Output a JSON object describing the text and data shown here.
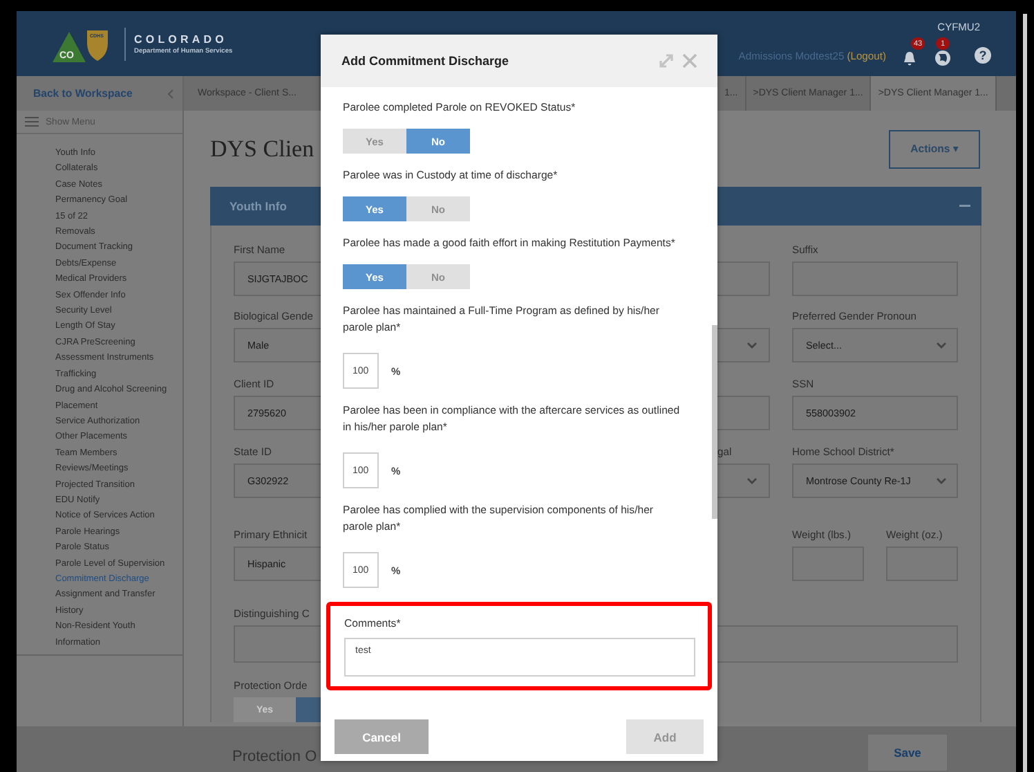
{
  "header": {
    "logo_mark": "CO",
    "logo_badge": "CDHS",
    "org_name": "COLORADO",
    "org_sub": "Department of Human Services",
    "user": "Admissions Modtest25",
    "logout": "(Logout)",
    "notifications": "43",
    "alerts": "1",
    "unit": "CYFMU2",
    "help": "?"
  },
  "sidebar": {
    "back": "Back to Workspace",
    "show_menu": "Show Menu",
    "items": [
      {
        "label": "Youth Info",
        "selected": false
      },
      {
        "label": "Collaterals",
        "selected": false
      },
      {
        "label": "Case Notes",
        "selected": false
      },
      {
        "label": "Permanency Goal",
        "selected": false
      },
      {
        "label": "15 of 22",
        "selected": false
      },
      {
        "label": "Removals",
        "selected": false
      },
      {
        "label": "Document Tracking",
        "selected": false
      },
      {
        "label": "Debts/Expense",
        "selected": false
      },
      {
        "label": "Medical Providers",
        "selected": false
      },
      {
        "label": "Sex Offender Info",
        "selected": false
      },
      {
        "label": "Security Level",
        "selected": false
      },
      {
        "label": "Length Of Stay",
        "selected": false
      },
      {
        "label": "CJRA PreScreening",
        "selected": false
      },
      {
        "label": "Assessment Instruments",
        "selected": false
      },
      {
        "label": "Trafficking",
        "selected": false
      },
      {
        "label": "Drug and Alcohol Screening",
        "selected": false
      },
      {
        "label": "Placement",
        "selected": false
      },
      {
        "label": "Service Authorization",
        "selected": false
      },
      {
        "label": "Other Placements",
        "selected": false
      },
      {
        "label": "Team Members",
        "selected": false
      },
      {
        "label": "Reviews/Meetings",
        "selected": false
      },
      {
        "label": "Projected Transition",
        "selected": false
      },
      {
        "label": "EDU Notify",
        "selected": false
      },
      {
        "label": "Notice of Services Action",
        "selected": false
      },
      {
        "label": "Parole Hearings",
        "selected": false
      },
      {
        "label": "Parole Status",
        "selected": false
      },
      {
        "label": "Parole Level of Supervision",
        "selected": false
      },
      {
        "label": "Commitment Discharge",
        "selected": true
      },
      {
        "label": "Assignment and Transfer History",
        "selected": false
      },
      {
        "label": "Non-Resident Youth Information",
        "selected": false
      }
    ]
  },
  "tabs": [
    {
      "label": "Workspace - Client S...",
      "selected": false
    },
    {
      "label": "1...",
      "selected": false
    },
    {
      "label": ">DYS Client Manager 1...",
      "selected": false
    },
    {
      "label": ">DYS Client Manager 1...",
      "selected": true
    }
  ],
  "main": {
    "title": "DYS Clien",
    "actions": "Actions ▾",
    "panel_title": "Youth Info",
    "form_left": [
      {
        "kind": "text",
        "label": "First Name",
        "value": "SIJGTAJBOC"
      },
      {
        "kind": "text",
        "label": "Biological Gende",
        "value": "Male"
      },
      {
        "kind": "text",
        "label": "Client ID",
        "value": "2795620"
      },
      {
        "kind": "text",
        "label": "State ID",
        "value": "G302922"
      },
      {
        "kind": "text",
        "label": "Primary Ethnicit",
        "value": "Hispanic"
      },
      {
        "kind": "textarea",
        "label": "Distinguishing C"
      },
      {
        "kind": "toggle",
        "label": "Protection Orde",
        "options": [
          {
            "label": "Yes",
            "selected": false
          },
          {
            "selected": true
          }
        ]
      }
    ],
    "form_right": [
      {
        "edge": {
          "kind": "text"
        },
        "field": {
          "kind": "text",
          "label": "Suffix"
        }
      },
      {
        "edge": {
          "kind": "select"
        },
        "field": {
          "kind": "select",
          "label": "Preferred Gender Pronoun",
          "placeholder": "Select..."
        }
      },
      {
        "edge": {
          "kind": "text"
        },
        "field": {
          "kind": "text",
          "label": "SSN",
          "value": "558003902"
        }
      },
      {
        "edge": {
          "kind": "select",
          "label": "gal"
        },
        "field": {
          "kind": "select",
          "label": "Home School District*",
          "value": "Montrose County Re-1J"
        }
      },
      {
        "field": {
          "kind": "pair",
          "fields": [
            {
              "label": "Weight (lbs.)"
            },
            {
              "label": "Weight (oz.)"
            }
          ]
        }
      },
      {
        "field": {
          "kind": "textarea"
        }
      }
    ]
  },
  "footer": {
    "section": "Protection O",
    "save": "Save"
  },
  "modal": {
    "title": "Add Commitment Discharge",
    "questions": [
      {
        "kind": "toggle",
        "label": "Parolee completed Parole on REVOKED Status*",
        "options": [
          {
            "label": "Yes",
            "selected": false
          },
          {
            "label": "No",
            "selected": true
          }
        ]
      },
      {
        "kind": "toggle",
        "label": "Parolee was in Custody at time of discharge*",
        "options": [
          {
            "label": "Yes",
            "selected": true
          },
          {
            "label": "No",
            "selected": false
          }
        ]
      },
      {
        "kind": "toggle",
        "label": "Parolee has made a good faith effort in making Restitution Payments*",
        "options": [
          {
            "label": "Yes",
            "selected": true
          },
          {
            "label": "No",
            "selected": false
          }
        ]
      },
      {
        "kind": "percent",
        "label": "Parolee has maintained a Full-Time Program as defined by his/her parole plan*",
        "value": "100",
        "unit": "%"
      },
      {
        "kind": "percent",
        "label": "Parolee has been in compliance with the aftercare services as outlined in his/her parole plan*",
        "value": "100",
        "unit": "%"
      },
      {
        "kind": "percent",
        "label": "Parolee has complied with the supervision components of his/her parole plan*",
        "value": "100",
        "unit": "%"
      },
      {
        "kind": "comments",
        "label": "Comments*",
        "value": "test",
        "highlighted": true
      }
    ],
    "buttons": [
      {
        "label": "Cancel",
        "disabled": false
      },
      {
        "label": "Add",
        "disabled": true
      }
    ]
  }
}
